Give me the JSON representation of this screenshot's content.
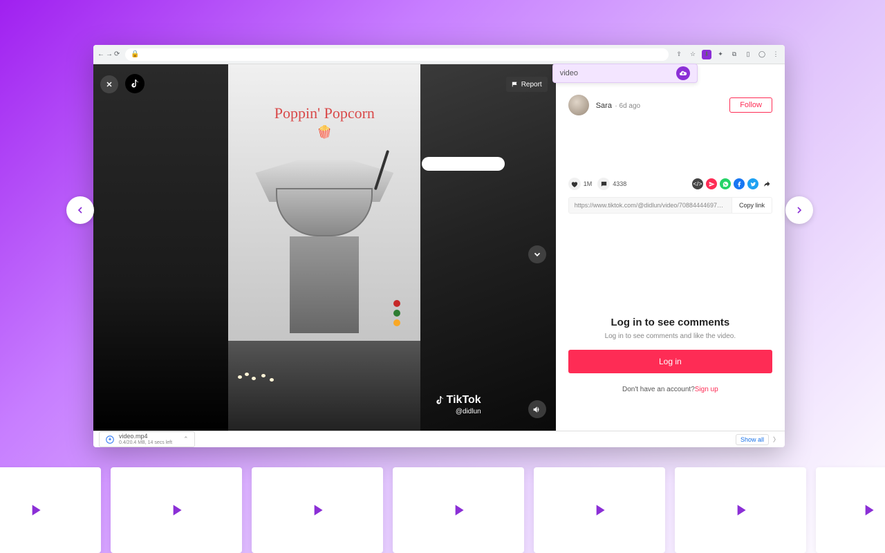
{
  "browser": {
    "url_display": "",
    "lock": "🔒",
    "back": "←",
    "forward": "→",
    "reload": "⟳",
    "star": "☆"
  },
  "extension_popup": {
    "label": "video"
  },
  "video": {
    "overlay_title": "Poppin' Popcorn",
    "overlay_emoji": "🍿",
    "report": "Report",
    "watermark_brand": "TikTok",
    "watermark_handle": "@didlun"
  },
  "user": {
    "name": "Sara",
    "meta": "6d ago",
    "follow": "Follow"
  },
  "stats": {
    "likes": "1M",
    "comments": "4338"
  },
  "link": {
    "url": "https://www.tiktok.com/@didlun/video/708844446976221…",
    "copy": "Copy link"
  },
  "login": {
    "title": "Log in to see comments",
    "subtitle": "Log in to see comments and like the video.",
    "button": "Log in",
    "signup_prompt": "Don't have an account?",
    "signup_link": "Sign up"
  },
  "download": {
    "filename": "video.mp4",
    "progress": "0.4/20.4 MB, 14 secs left",
    "show_all": "Show all"
  }
}
